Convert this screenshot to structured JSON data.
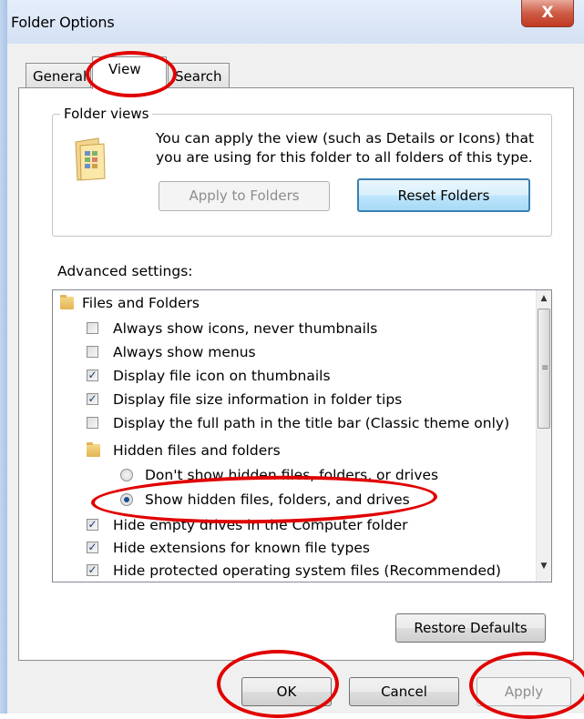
{
  "window": {
    "title": "Folder Options",
    "close_label": "X"
  },
  "tabs": [
    {
      "label": "General"
    },
    {
      "label": "View"
    },
    {
      "label": "Search"
    }
  ],
  "folder_views": {
    "label": "Folder views",
    "description_line1": "You can apply the view (such as Details or Icons) that",
    "description_line2": "you are using for this folder to all folders of this type.",
    "apply_to_folders_label": "Apply to Folders",
    "reset_folders_label": "Reset Folders"
  },
  "advanced": {
    "label": "Advanced settings:",
    "items": [
      {
        "type": "folder",
        "label": "Files and Folders"
      },
      {
        "type": "checkbox",
        "checked": false,
        "label": "Always show icons, never thumbnails"
      },
      {
        "type": "checkbox",
        "checked": false,
        "label": "Always show menus"
      },
      {
        "type": "checkbox",
        "checked": true,
        "label": "Display file icon on thumbnails"
      },
      {
        "type": "checkbox",
        "checked": true,
        "label": "Display file size information in folder tips"
      },
      {
        "type": "checkbox",
        "checked": false,
        "label": "Display the full path in the title bar (Classic theme only)"
      },
      {
        "type": "folder",
        "label": "Hidden files and folders"
      },
      {
        "type": "radio",
        "checked": false,
        "label": "Don't show hidden files, folders, or drives"
      },
      {
        "type": "radio",
        "checked": true,
        "label": "Show hidden files, folders, and drives"
      },
      {
        "type": "checkbox",
        "checked": true,
        "label": "Hide empty drives in the Computer folder"
      },
      {
        "type": "checkbox",
        "checked": true,
        "label": "Hide extensions for known file types"
      },
      {
        "type": "checkbox",
        "checked": true,
        "label": "Hide protected operating system files (Recommended)"
      }
    ]
  },
  "buttons": {
    "restore_defaults": "Restore Defaults",
    "ok": "OK",
    "cancel": "Cancel",
    "apply": "Apply"
  },
  "icons": {
    "close": "close-icon",
    "folder": "folder-icon",
    "folder_views": "folder-views-icon",
    "scroll_up": "scroll-up-icon",
    "scroll_down": "scroll-down-icon"
  },
  "colors": {
    "annotation_red": "#e00000",
    "default_button_border": "#3c7fb1",
    "close_button": "#c23b22"
  }
}
